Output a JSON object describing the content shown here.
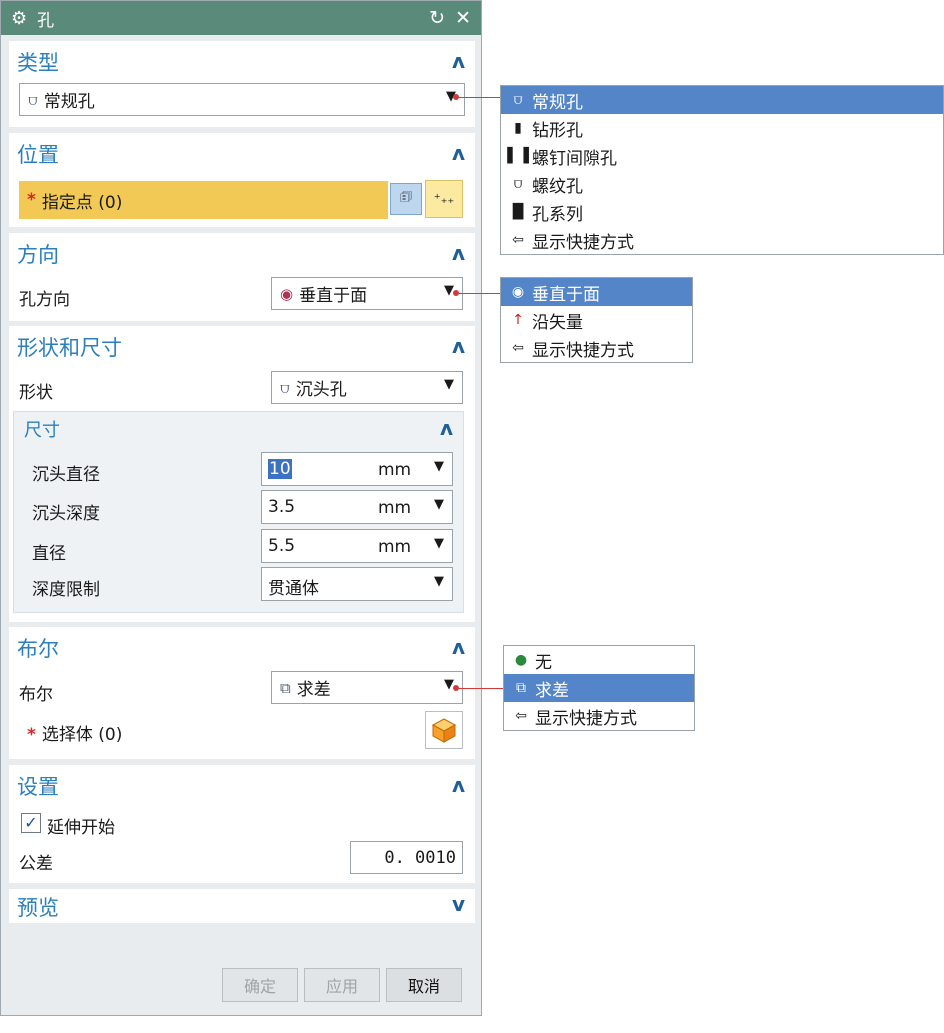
{
  "dialog": {
    "title": "孔",
    "type_section": {
      "title": "类型",
      "selected": "常规孔"
    },
    "position_section": {
      "title": "位置",
      "specify_point": "指定点 (0)"
    },
    "direction_section": {
      "title": "方向",
      "hole_direction_label": "孔方向",
      "hole_direction_value": "垂直于面"
    },
    "shape_section": {
      "title": "形状和尺寸",
      "shape_label": "形状",
      "shape_value": "沉头孔",
      "dims": {
        "title": "尺寸",
        "counterbore_diameter_label": "沉头直径",
        "counterbore_diameter_value": "10",
        "counterbore_diameter_unit": "mm",
        "counterbore_depth_label": "沉头深度",
        "counterbore_depth_value": "3.5",
        "counterbore_depth_unit": "mm",
        "diameter_label": "直径",
        "diameter_value": "5.5",
        "diameter_unit": "mm",
        "depth_limit_label": "深度限制",
        "depth_limit_value": "贯通体"
      }
    },
    "boolean_section": {
      "title": "布尔",
      "boolean_label": "布尔",
      "boolean_value": "求差",
      "select_body": "选择体 (0)"
    },
    "settings_section": {
      "title": "设置",
      "extend_start": "延伸开始",
      "extend_start_checked": true,
      "tolerance_label": "公差",
      "tolerance_value": "0. 0010"
    },
    "preview_section": {
      "title": "预览"
    },
    "buttons": {
      "ok": "确定",
      "apply": "应用",
      "cancel": "取消"
    }
  },
  "type_menu": [
    "常规孔",
    "钻形孔",
    "螺钉间隙孔",
    "螺纹孔",
    "孔系列",
    "显示快捷方式"
  ],
  "direction_menu": [
    "垂直于面",
    "沿矢量",
    "显示快捷方式"
  ],
  "boolean_menu": [
    "无",
    "求差",
    "显示快捷方式"
  ],
  "colors": {
    "title_bar": "#5a8a7a",
    "section_title": "#2c7fbd",
    "highlight": "#5485c8",
    "required_row": "#f2c955",
    "leader": "#d7393a"
  }
}
